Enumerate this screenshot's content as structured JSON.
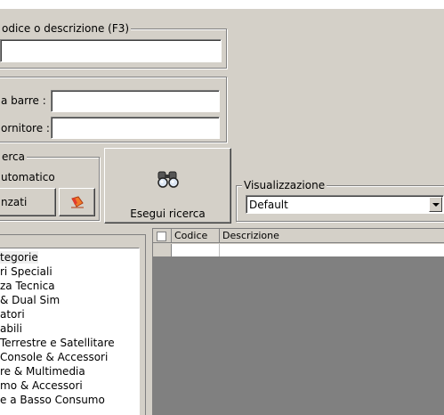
{
  "search": {
    "code_group_legend": "odice o descrizione (F3)",
    "code_value": "",
    "barcode_label": "a barre :",
    "barcode_value": "",
    "supplier_label": "ornitore :",
    "supplier_value": ""
  },
  "search_mode": {
    "legend": "erca",
    "automatic_label": "utomatico",
    "advanced_button": "nzati",
    "flag_icon": "eraser-icon"
  },
  "run_search": {
    "label": "Esegui ricerca",
    "icon": "binoculars-icon"
  },
  "view": {
    "legend": "Visualizzazione",
    "selected": "Default"
  },
  "categories": [
    "tegorie",
    "ri Speciali",
    "za Tecnica",
    "& Dual Sim",
    "atori",
    "abili",
    "Terrestre e Satellitare",
    "Console & Accessori",
    "re & Multimedia",
    "mo & Accessori",
    "e a Basso Consumo"
  ],
  "grid": {
    "columns": [
      "",
      "Codice",
      "Descrizione"
    ]
  },
  "colors": {
    "face": "#d4d0c8",
    "grid_background": "#808080",
    "shadow": "#808080",
    "highlight": "#ffffff"
  }
}
